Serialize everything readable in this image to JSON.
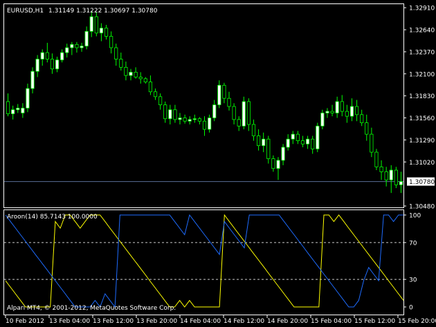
{
  "colors": {
    "background": "#000000",
    "frame": "#ffffff",
    "bull_candle": "#ffffff",
    "bear_candle": "#000000",
    "wick": "#00ff00",
    "aroon_up": "#ffff00",
    "aroon_down": "#1e6cff",
    "level_line": "#ffffff",
    "bid_line": "#5a6e96",
    "price_box_bg": "#ffffff",
    "price_box_text": "#000000"
  },
  "main_chart": {
    "symbol_label": "EURUSD,H1",
    "ohlc_label": "1.31149 1.31222 1.30697 1.30780"
  },
  "indicator": {
    "label": "Aroon(14) 85.7143 100.0000"
  },
  "footer": {
    "copyright": "Alpari MT4, © 2001-2012, MetaQuotes Software Corp."
  },
  "chart_data": [
    {
      "type": "candlestick",
      "symbol": "EURUSD",
      "timeframe": "H1",
      "ylim": [
        1.3048,
        1.3292
      ],
      "y_ticks": [
        "1.32910",
        "1.32640",
        "1.32370",
        "1.32100",
        "1.31830",
        "1.31560",
        "1.31290",
        "1.31020",
        "1.30780",
        "1.30480"
      ],
      "x_ticks": [
        "10 Feb 2012",
        "13 Feb 04:00",
        "13 Feb 12:00",
        "13 Feb 20:00",
        "14 Feb 04:00",
        "14 Feb 12:00",
        "14 Feb 20:00",
        "15 Feb 04:00",
        "15 Feb 12:00",
        "15 Feb 20:00"
      ],
      "current_price": 1.3078,
      "candles": [
        [
          1.3176,
          1.3186,
          1.3158,
          1.3161
        ],
        [
          1.3161,
          1.3171,
          1.3154,
          1.3166
        ],
        [
          1.3166,
          1.3173,
          1.3162,
          1.3168
        ],
        [
          1.3162,
          1.3174,
          1.3156,
          1.3168
        ],
        [
          1.3168,
          1.3198,
          1.3163,
          1.3192
        ],
        [
          1.3192,
          1.3218,
          1.3186,
          1.3213
        ],
        [
          1.3213,
          1.3233,
          1.3206,
          1.3228
        ],
        [
          1.3228,
          1.324,
          1.322,
          1.3236
        ],
        [
          1.3236,
          1.3248,
          1.3224,
          1.3228
        ],
        [
          1.3228,
          1.3235,
          1.321,
          1.3216
        ],
        [
          1.3216,
          1.3231,
          1.3212,
          1.3227
        ],
        [
          1.3227,
          1.324,
          1.3224,
          1.3236
        ],
        [
          1.3236,
          1.3247,
          1.323,
          1.3242
        ],
        [
          1.3242,
          1.3249,
          1.3233,
          1.3246
        ],
        [
          1.3246,
          1.3249,
          1.3236,
          1.3242
        ],
        [
          1.3242,
          1.3248,
          1.3237,
          1.3244
        ],
        [
          1.3244,
          1.3268,
          1.324,
          1.3262
        ],
        [
          1.3262,
          1.3287,
          1.3255,
          1.328
        ],
        [
          1.328,
          1.3286,
          1.3256,
          1.326
        ],
        [
          1.326,
          1.3272,
          1.325,
          1.3266
        ],
        [
          1.3266,
          1.327,
          1.3252,
          1.3256
        ],
        [
          1.3256,
          1.3262,
          1.3235,
          1.3242
        ],
        [
          1.3242,
          1.3247,
          1.322,
          1.3228
        ],
        [
          1.3228,
          1.3236,
          1.3214,
          1.3218
        ],
        [
          1.3218,
          1.3225,
          1.3202,
          1.3208
        ],
        [
          1.3208,
          1.3216,
          1.3202,
          1.3212
        ],
        [
          1.3212,
          1.3218,
          1.3204,
          1.3206
        ],
        [
          1.3206,
          1.3212,
          1.3198,
          1.3204
        ],
        [
          1.3204,
          1.3206,
          1.3198,
          1.32
        ],
        [
          1.32,
          1.3208,
          1.3184,
          1.3188
        ],
        [
          1.3188,
          1.3192,
          1.3178,
          1.3182
        ],
        [
          1.3182,
          1.3186,
          1.3166,
          1.3172
        ],
        [
          1.3172,
          1.3176,
          1.315,
          1.3155
        ],
        [
          1.3155,
          1.3172,
          1.3148,
          1.3166
        ],
        [
          1.3166,
          1.3172,
          1.315,
          1.3154
        ],
        [
          1.3154,
          1.3162,
          1.3148,
          1.3156
        ],
        [
          1.3156,
          1.316,
          1.3149,
          1.3152
        ],
        [
          1.3152,
          1.3158,
          1.3148,
          1.3154
        ],
        [
          1.3154,
          1.316,
          1.315,
          1.3155
        ],
        [
          1.3155,
          1.3157,
          1.3148,
          1.3152
        ],
        [
          1.3152,
          1.3158,
          1.3134,
          1.3142
        ],
        [
          1.3142,
          1.316,
          1.3138,
          1.3156
        ],
        [
          1.3156,
          1.3178,
          1.3152,
          1.3172
        ],
        [
          1.3172,
          1.3202,
          1.3168,
          1.3196
        ],
        [
          1.3196,
          1.3199,
          1.3174,
          1.318
        ],
        [
          1.318,
          1.3188,
          1.3165,
          1.317
        ],
        [
          1.317,
          1.3174,
          1.3148,
          1.3154
        ],
        [
          1.3154,
          1.3158,
          1.314,
          1.3146
        ],
        [
          1.3146,
          1.3182,
          1.3142,
          1.3176
        ],
        [
          1.3176,
          1.318,
          1.314,
          1.3148
        ],
        [
          1.3148,
          1.3154,
          1.3128,
          1.3134
        ],
        [
          1.3134,
          1.3142,
          1.3116,
          1.3122
        ],
        [
          1.3122,
          1.3138,
          1.3114,
          1.313
        ],
        [
          1.313,
          1.3134,
          1.31,
          1.3106
        ],
        [
          1.3106,
          1.311,
          1.309,
          1.3094
        ],
        [
          1.3094,
          1.3108,
          1.308,
          1.3104
        ],
        [
          1.3104,
          1.3124,
          1.3098,
          1.312
        ],
        [
          1.312,
          1.3136,
          1.3116,
          1.313
        ],
        [
          1.313,
          1.314,
          1.3124,
          1.3136
        ],
        [
          1.3136,
          1.314,
          1.3124,
          1.3128
        ],
        [
          1.3128,
          1.3134,
          1.312,
          1.3124
        ],
        [
          1.3124,
          1.3134,
          1.3118,
          1.313
        ],
        [
          1.313,
          1.3134,
          1.3112,
          1.3118
        ],
        [
          1.3118,
          1.315,
          1.3114,
          1.3146
        ],
        [
          1.3146,
          1.3166,
          1.3142,
          1.3162
        ],
        [
          1.3162,
          1.3168,
          1.3156,
          1.3164
        ],
        [
          1.3164,
          1.3172,
          1.3158,
          1.3162
        ],
        [
          1.3162,
          1.3182,
          1.3156,
          1.3176
        ],
        [
          1.3176,
          1.3184,
          1.3158,
          1.3164
        ],
        [
          1.3164,
          1.3172,
          1.315,
          1.3158
        ],
        [
          1.3158,
          1.318,
          1.3152,
          1.317
        ],
        [
          1.317,
          1.3178,
          1.3152,
          1.316
        ],
        [
          1.316,
          1.3166,
          1.3146,
          1.315
        ],
        [
          1.315,
          1.316,
          1.3128,
          1.3136
        ],
        [
          1.3136,
          1.3144,
          1.3108,
          1.3114
        ],
        [
          1.3114,
          1.3118,
          1.3092,
          1.3096
        ],
        [
          1.3096,
          1.3104,
          1.308,
          1.309
        ],
        [
          1.309,
          1.3096,
          1.3072,
          1.308
        ],
        [
          1.308,
          1.3098,
          1.3064,
          1.3092
        ],
        [
          1.3092,
          1.3096,
          1.307,
          1.3074
        ],
        [
          1.3074,
          1.309,
          1.3064,
          1.3078
        ]
      ]
    },
    {
      "type": "line",
      "indicator": "Aroon(14)",
      "ylim": [
        0,
        100
      ],
      "y_ticks": [
        "100",
        "70",
        "30",
        "0"
      ],
      "levels": [
        70,
        30
      ],
      "series": [
        {
          "name": "Aroon Up",
          "color": "#ffff00",
          "values": [
            28.6,
            21.4,
            14.3,
            7.1,
            0,
            0,
            0,
            0,
            0,
            0,
            92.9,
            85.7,
            100,
            100,
            92.9,
            85.7,
            92.9,
            100,
            100,
            100,
            92.9,
            85.7,
            78.6,
            71.4,
            64.3,
            57.1,
            50,
            42.9,
            35.7,
            28.6,
            21.4,
            14.3,
            7.1,
            0,
            0,
            7.1,
            0,
            7.1,
            0,
            0,
            0,
            0,
            0,
            0,
            100,
            92.9,
            85.7,
            78.6,
            71.4,
            64.3,
            57.1,
            50,
            42.9,
            35.7,
            28.6,
            21.4,
            14.3,
            7.1,
            0,
            0,
            0,
            0,
            0,
            0,
            100,
            100,
            92.9,
            100,
            92.9,
            85.7,
            78.6,
            71.4,
            64.3,
            57.1,
            50,
            42.9,
            35.7,
            28.6,
            21.4,
            14.3,
            7.1
          ]
        },
        {
          "name": "Aroon Down",
          "color": "#1e6cff",
          "values": [
            100,
            92.9,
            85.7,
            78.6,
            71.4,
            64.3,
            57.1,
            50,
            42.9,
            35.7,
            28.6,
            21.4,
            14.3,
            7.1,
            0,
            0,
            0,
            0,
            7.1,
            0,
            14.3,
            7.1,
            0,
            100,
            100,
            100,
            100,
            100,
            100,
            100,
            100,
            100,
            100,
            100,
            92.9,
            85.7,
            78.6,
            100,
            92.9,
            85.7,
            78.6,
            71.4,
            64.3,
            57.1,
            92.9,
            85.7,
            78.6,
            71.4,
            64.3,
            100,
            100,
            100,
            100,
            100,
            100,
            100,
            92.9,
            85.7,
            78.6,
            71.4,
            64.3,
            57.1,
            50,
            42.9,
            35.7,
            28.6,
            21.4,
            14.3,
            7.1,
            0,
            0,
            7.1,
            28.6,
            42.9,
            35.7,
            28.6,
            100,
            100,
            92.9,
            100,
            100
          ]
        }
      ]
    }
  ]
}
